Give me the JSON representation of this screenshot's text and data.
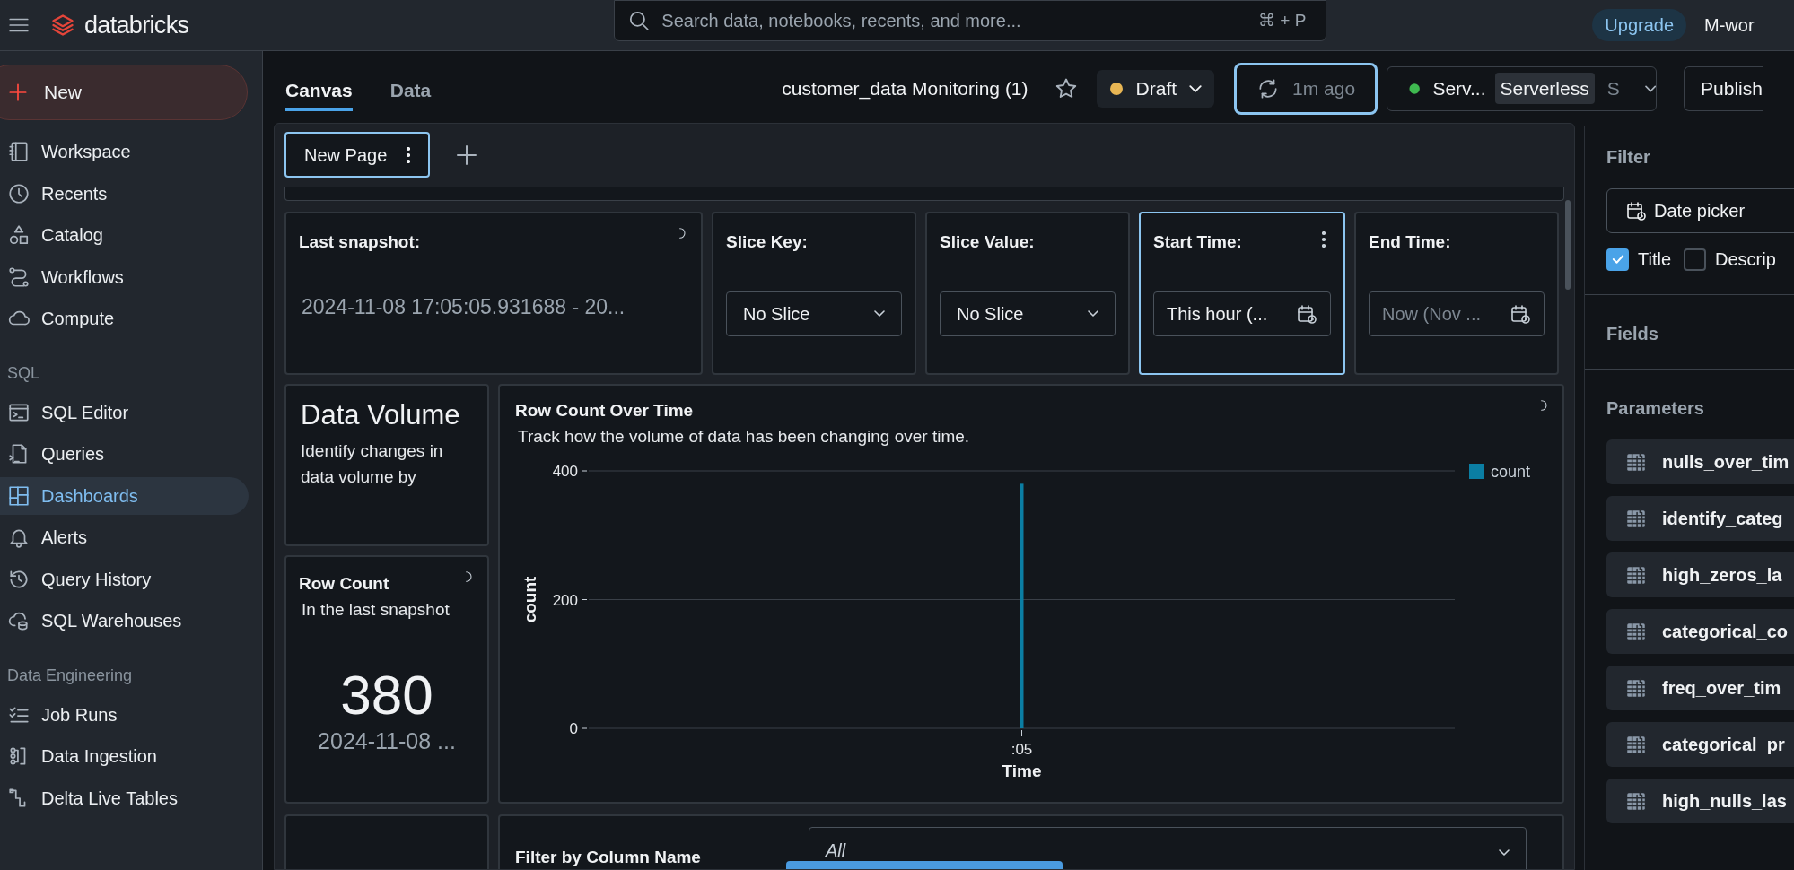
{
  "top_bar": {
    "app_name": "databricks",
    "search": {
      "placeholder": "Search data, notebooks, recents, and more...",
      "shortcut": "⌘ + P"
    },
    "upgrade": "Upgrade",
    "workspace": "M-wor"
  },
  "sidebar": {
    "new_button": "New",
    "sections": [
      {
        "items": [
          {
            "label": "Workspace",
            "selected": false
          },
          {
            "label": "Recents",
            "selected": false
          },
          {
            "label": "Catalog",
            "selected": false
          },
          {
            "label": "Workflows",
            "selected": false
          },
          {
            "label": "Compute",
            "selected": false
          }
        ]
      },
      {
        "heading": "SQL",
        "items": [
          {
            "label": "SQL Editor",
            "selected": false
          },
          {
            "label": "Queries",
            "selected": false
          },
          {
            "label": "Dashboards",
            "selected": true
          },
          {
            "label": "Alerts",
            "selected": false
          },
          {
            "label": "Query History",
            "selected": false
          },
          {
            "label": "SQL Warehouses",
            "selected": false
          }
        ]
      },
      {
        "heading": "Data Engineering",
        "items": [
          {
            "label": "Job Runs",
            "selected": false
          },
          {
            "label": "Data Ingestion",
            "selected": false
          },
          {
            "label": "Delta Live Tables",
            "selected": false
          }
        ]
      }
    ]
  },
  "editor_header": {
    "tabs": [
      {
        "label": "Canvas",
        "selected": true
      },
      {
        "label": "Data",
        "selected": false
      }
    ],
    "title": "customer_data Monitoring (1)",
    "status": "Draft",
    "refresh": "1m ago",
    "compute": {
      "label": "Serv...",
      "badge": "Serverless",
      "extra": "S"
    },
    "publish": "Publish"
  },
  "pages": [
    {
      "label": "New Page",
      "selected": true
    }
  ],
  "filter_widgets": [
    {
      "kind": "text",
      "title": "Last snapshot:",
      "value": "2024-11-08 17:05:05.931688 - 20...",
      "selected": false
    },
    {
      "kind": "dropdown",
      "title": "Slice Key:",
      "value": "No Slice",
      "selected": false
    },
    {
      "kind": "dropdown",
      "title": "Slice Value:",
      "value": "No Slice",
      "selected": false
    },
    {
      "kind": "date",
      "title": "Start Time:",
      "value": "This hour (...",
      "selected": true
    },
    {
      "kind": "date",
      "title": "End Time:",
      "placeholder": "Now (Nov ...",
      "selected": false
    }
  ],
  "data_volume": {
    "title": "Data Volume",
    "description": "Identify changes in data volume by"
  },
  "row_count": {
    "title": "Row Count",
    "subtitle": "In the last snapshot",
    "value": "380",
    "date": "2024-11-08 ..."
  },
  "row_count_chart": {
    "title": "Row Count Over Time",
    "description": "Track how the volume of data has been changing over time.",
    "chart_data": {
      "type": "bar",
      "xlabel": "Time",
      "ylabel": "count",
      "categories": [
        ":05"
      ],
      "series": [
        {
          "name": "count",
          "color": "#0b7ea3",
          "values": [
            380
          ]
        }
      ],
      "ylim": [
        0,
        400
      ],
      "yticks": [
        0,
        200,
        400
      ]
    }
  },
  "column_filter": {
    "title": "Filter by Column Name",
    "value": "All"
  },
  "right_panel": {
    "filter_heading": "Filter",
    "widget_type": "Date picker",
    "options": [
      {
        "label": "Title",
        "checked": true
      },
      {
        "label": "Descrip",
        "checked": false
      }
    ],
    "fields_heading": "Fields",
    "parameters_heading": "Parameters",
    "parameters": [
      "nulls_over_tim",
      "identify_categ",
      "high_zeros_la",
      "categorical_co",
      "freq_over_tim",
      "categorical_pr",
      "high_nulls_las"
    ]
  }
}
